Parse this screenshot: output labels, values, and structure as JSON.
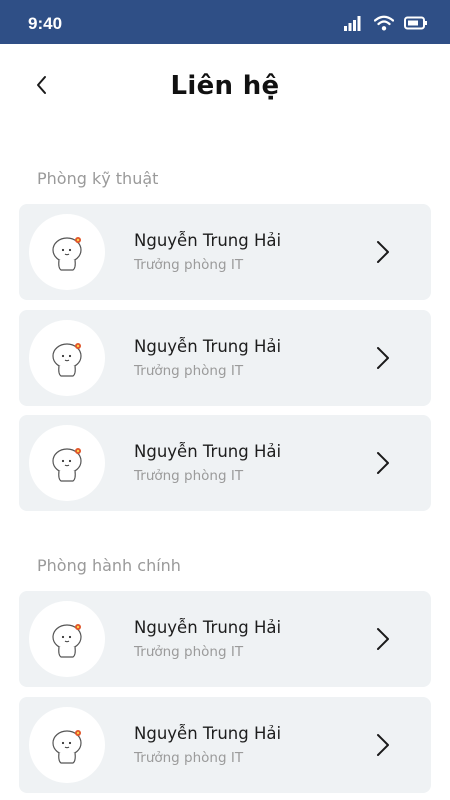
{
  "status_bar": {
    "time": "9:40",
    "icons": [
      "signal-icon",
      "wifi-icon",
      "battery-icon"
    ]
  },
  "header": {
    "title": "Liên hệ",
    "back_icon": "chevron-left-icon"
  },
  "sections": [
    {
      "title": "Phòng kỹ thuật",
      "contacts": [
        {
          "name": "Nguyễn Trung Hải",
          "role": "Trưởng phòng IT"
        },
        {
          "name": "Nguyễn Trung Hải",
          "role": "Trưởng phòng IT"
        },
        {
          "name": "Nguyễn Trung Hải",
          "role": "Trưởng phòng IT"
        }
      ]
    },
    {
      "title": "Phòng hành chính",
      "contacts": [
        {
          "name": "Nguyễn Trung Hải",
          "role": "Trưởng phòng IT"
        },
        {
          "name": "Nguyễn Trung Hải",
          "role": "Trưởng phòng IT"
        }
      ]
    }
  ],
  "colors": {
    "status_bar": "#2f4f86",
    "card_background": "#eff2f4",
    "section_title": "#9a9a9a",
    "avatar_flower": "#e0552b"
  }
}
